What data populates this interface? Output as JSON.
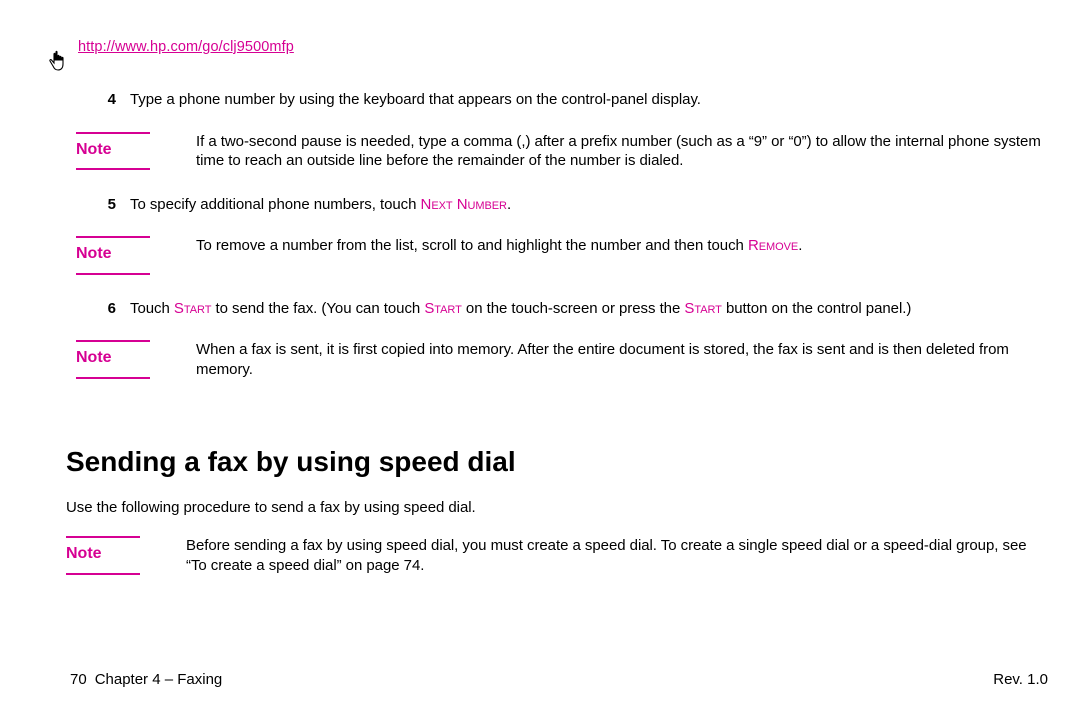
{
  "url": "http://www.hp.com/go/clj9500mfp",
  "steps": {
    "s4": {
      "num": "4",
      "text": "Type a phone number by using the keyboard that appears on the control-panel display."
    },
    "s5": {
      "num": "5",
      "prefix": "To specify additional phone numbers, touch ",
      "smallcap": "Next Number",
      "suffix": "."
    },
    "s6": {
      "num": "6",
      "a": "Touch ",
      "sc1": "Start",
      "b": " to send the fax. (You can touch ",
      "sc2": "Start",
      "c": " on the touch-screen or press the ",
      "sc3": "Start",
      "d": " button on the control panel.)"
    }
  },
  "notes": {
    "label": "Note",
    "n1": "If a two-second pause is needed, type a comma (,) after a prefix number (such as a “9” or “0”) to allow the internal phone system time to reach an outside line before the remainder of the number is dialed.",
    "n2a": "To remove a number from the list, scroll to and highlight the number and then touch ",
    "n2sc": "Remove",
    "n2b": ".",
    "n3": "When a fax is sent, it is first copied into memory. After the entire document is stored, the fax is sent and is then deleted from memory.",
    "n4": "Before sending a fax by using speed dial, you must create a speed dial. To create a single speed dial or a speed-dial group, see “To create a speed dial” on page 74."
  },
  "heading": "Sending a fax by using speed dial",
  "intro": "Use the following procedure to send a fax by using speed dial.",
  "footer": {
    "page": "70",
    "chapter": "Chapter 4 – Faxing",
    "rev": "Rev. 1.0"
  }
}
